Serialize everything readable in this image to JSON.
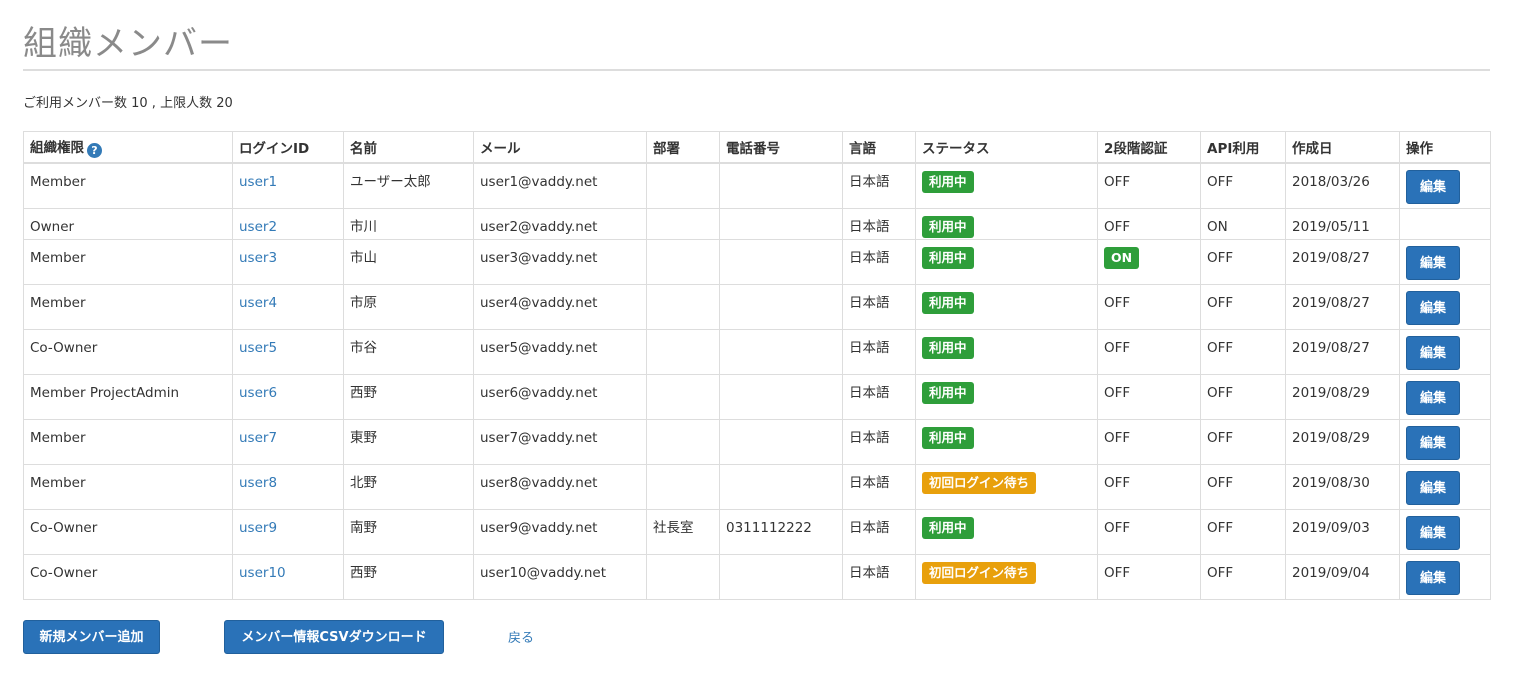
{
  "page": {
    "title": "組織メンバー",
    "summary": "ご利用メンバー数 10 , 上限人数 20"
  },
  "table": {
    "headers": {
      "role": "組織権限",
      "role_help_icon": "question-circle-icon",
      "login_id": "ログインID",
      "name": "名前",
      "mail": "メール",
      "department": "部署",
      "phone": "電話番号",
      "language": "言語",
      "status": "ステータス",
      "two_factor": "2段階認証",
      "api": "API利用",
      "created": "作成日",
      "actions": "操作"
    },
    "help_glyph": "?",
    "edit_label": "編集",
    "rows": [
      {
        "role": "Member",
        "login_id": "user1",
        "name": "ユーザー太郎",
        "mail": "user1@vaddy.net",
        "department": "",
        "phone": "",
        "language": "日本語",
        "status": "利用中",
        "two_factor": "OFF",
        "api": "OFF",
        "created": "2018/03/26",
        "editable": true
      },
      {
        "role": "Owner",
        "login_id": "user2",
        "name": "市川",
        "mail": "user2@vaddy.net",
        "department": "",
        "phone": "",
        "language": "日本語",
        "status": "利用中",
        "two_factor": "OFF",
        "api": "ON",
        "created": "2019/05/11",
        "editable": false
      },
      {
        "role": "Member",
        "login_id": "user3",
        "name": "市山",
        "mail": "user3@vaddy.net",
        "department": "",
        "phone": "",
        "language": "日本語",
        "status": "利用中",
        "two_factor": "ON",
        "api": "OFF",
        "created": "2019/08/27",
        "editable": true
      },
      {
        "role": "Member",
        "login_id": "user4",
        "name": "市原",
        "mail": "user4@vaddy.net",
        "department": "",
        "phone": "",
        "language": "日本語",
        "status": "利用中",
        "two_factor": "OFF",
        "api": "OFF",
        "created": "2019/08/27",
        "editable": true
      },
      {
        "role": "Co-Owner",
        "login_id": "user5",
        "name": "市谷",
        "mail": "user5@vaddy.net",
        "department": "",
        "phone": "",
        "language": "日本語",
        "status": "利用中",
        "two_factor": "OFF",
        "api": "OFF",
        "created": "2019/08/27",
        "editable": true
      },
      {
        "role": "Member ProjectAdmin",
        "login_id": "user6",
        "name": "西野",
        "mail": "user6@vaddy.net",
        "department": "",
        "phone": "",
        "language": "日本語",
        "status": "利用中",
        "two_factor": "OFF",
        "api": "OFF",
        "created": "2019/08/29",
        "editable": true
      },
      {
        "role": "Member",
        "login_id": "user7",
        "name": "東野",
        "mail": "user7@vaddy.net",
        "department": "",
        "phone": "",
        "language": "日本語",
        "status": "利用中",
        "two_factor": "OFF",
        "api": "OFF",
        "created": "2019/08/29",
        "editable": true
      },
      {
        "role": "Member",
        "login_id": "user8",
        "name": "北野",
        "mail": "user8@vaddy.net",
        "department": "",
        "phone": "",
        "language": "日本語",
        "status": "初回ログイン待ち",
        "two_factor": "OFF",
        "api": "OFF",
        "created": "2019/08/30",
        "editable": true
      },
      {
        "role": "Co-Owner",
        "login_id": "user9",
        "name": "南野",
        "mail": "user9@vaddy.net",
        "department": "社長室",
        "phone": "0311112222",
        "language": "日本語",
        "status": "利用中",
        "two_factor": "OFF",
        "api": "OFF",
        "created": "2019/09/03",
        "editable": true
      },
      {
        "role": "Co-Owner",
        "login_id": "user10",
        "name": "西野",
        "mail": "user10@vaddy.net",
        "department": "",
        "phone": "",
        "language": "日本語",
        "status": "初回ログイン待ち",
        "two_factor": "OFF",
        "api": "OFF",
        "created": "2019/09/04",
        "editable": true
      }
    ]
  },
  "actions": {
    "add_member": "新規メンバー追加",
    "csv_download": "メンバー情報CSVダウンロード",
    "back": "戻る"
  },
  "colors": {
    "status_active": "#2e9e3a",
    "status_pending": "#e8a00c",
    "primary": "#2a72b8",
    "link": "#337ab7"
  }
}
